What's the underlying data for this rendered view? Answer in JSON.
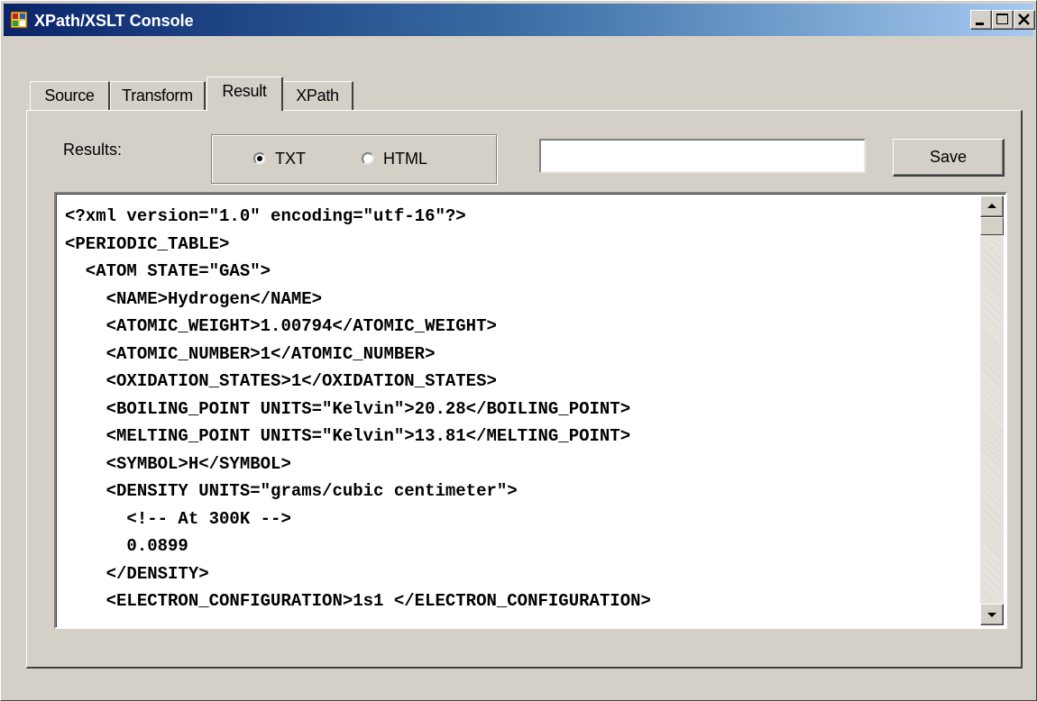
{
  "window": {
    "title": "XPath/XSLT Console",
    "icons": {
      "app": "app-window-icon",
      "minimize": "minimize-icon",
      "maximize": "maximize-icon",
      "close": "close-icon"
    }
  },
  "tabs": [
    {
      "label": "Source",
      "active": false
    },
    {
      "label": "Transform",
      "active": false
    },
    {
      "label": "Result",
      "active": true
    },
    {
      "label": "XPath",
      "active": false
    }
  ],
  "results": {
    "label": "Results:",
    "modes": [
      {
        "label": "TXT",
        "selected": true
      },
      {
        "label": "HTML",
        "selected": false
      }
    ],
    "path_input": {
      "value": "",
      "placeholder": ""
    },
    "save_label": "Save"
  },
  "output": {
    "lines": [
      "<?xml version=\"1.0\" encoding=\"utf-16\"?>",
      "<PERIODIC_TABLE>",
      "  <ATOM STATE=\"GAS\">",
      "    <NAME>Hydrogen</NAME>",
      "    <ATOMIC_WEIGHT>1.00794</ATOMIC_WEIGHT>",
      "    <ATOMIC_NUMBER>1</ATOMIC_NUMBER>",
      "    <OXIDATION_STATES>1</OXIDATION_STATES>",
      "    <BOILING_POINT UNITS=\"Kelvin\">20.28</BOILING_POINT>",
      "    <MELTING_POINT UNITS=\"Kelvin\">13.81</MELTING_POINT>",
      "    <SYMBOL>H</SYMBOL>",
      "    <DENSITY UNITS=\"grams/cubic centimeter\">",
      "      <!-- At 300K -->",
      "      0.0899",
      "    </DENSITY>",
      "    <ELECTRON_CONFIGURATION>1s1 </ELECTRON_CONFIGURATION>"
    ],
    "scroll_position": 0.0
  }
}
